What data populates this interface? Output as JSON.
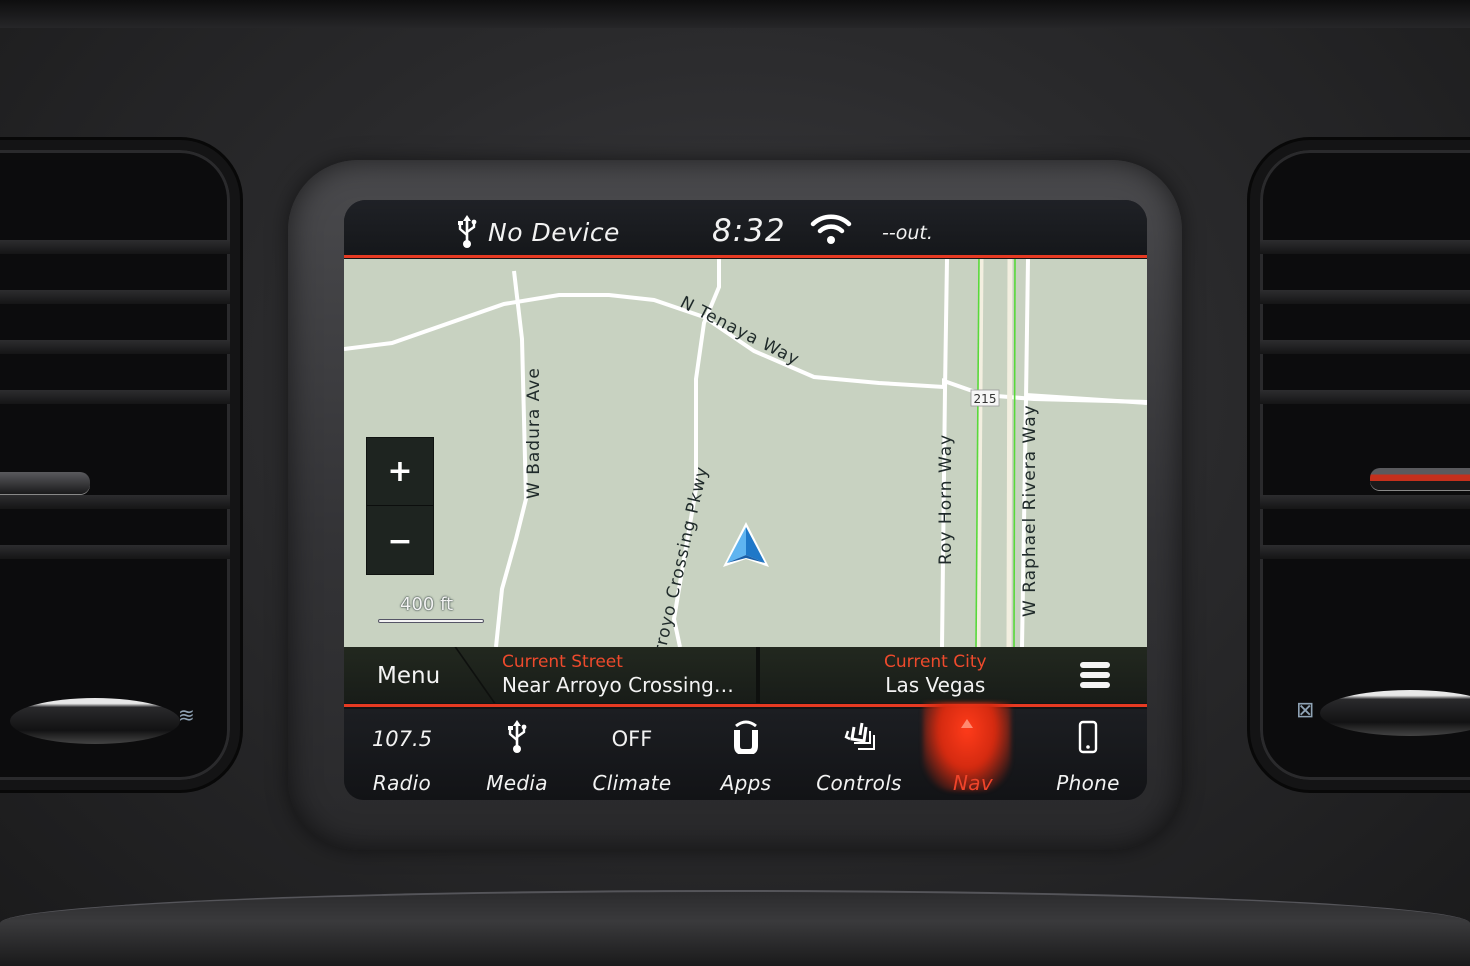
{
  "status_bar": {
    "device_icon": "usb-icon",
    "device_label": "No Device",
    "clock": "8:32",
    "wifi_icon": "wifi-icon",
    "outside_temp": "--out."
  },
  "map": {
    "zoom_in_label": "+",
    "zoom_out_label": "−",
    "scale_label": "400 ft",
    "roads": [
      {
        "name": "N Tenaya Way"
      },
      {
        "name": "W Badura Ave"
      },
      {
        "name": "Arroyo Crossing Pkwy"
      },
      {
        "name": "Roy Horn Way"
      },
      {
        "name": "W Raphael Rivera Way"
      }
    ],
    "highway_shield": "215",
    "position_icon": "navigation-arrow-icon"
  },
  "info_bar": {
    "menu_label": "Menu",
    "current_street_title": "Current Street",
    "current_street_value": "Near Arroyo Crossing…",
    "current_city_title": "Current City",
    "current_city_value": "Las Vegas",
    "options_icon": "hamburger-menu-icon"
  },
  "dock": {
    "items": [
      {
        "label": "Radio",
        "top_text": "107.5",
        "active": false
      },
      {
        "label": "Media",
        "icon": "usb-icon",
        "active": false
      },
      {
        "label": "Climate",
        "top_text": "OFF",
        "active": false
      },
      {
        "label": "Apps",
        "icon": "uconnect-apps-icon",
        "active": false
      },
      {
        "label": "Controls",
        "icon": "seat-controls-icon",
        "active": false
      },
      {
        "label": "Nav",
        "icon": "active-caret-icon",
        "active": true
      },
      {
        "label": "Phone",
        "icon": "phone-icon",
        "active": false
      }
    ]
  },
  "colors": {
    "accent_red": "#e63a22",
    "map_background": "#c8d2c1",
    "nav_arrow": "#2f8fe0"
  }
}
